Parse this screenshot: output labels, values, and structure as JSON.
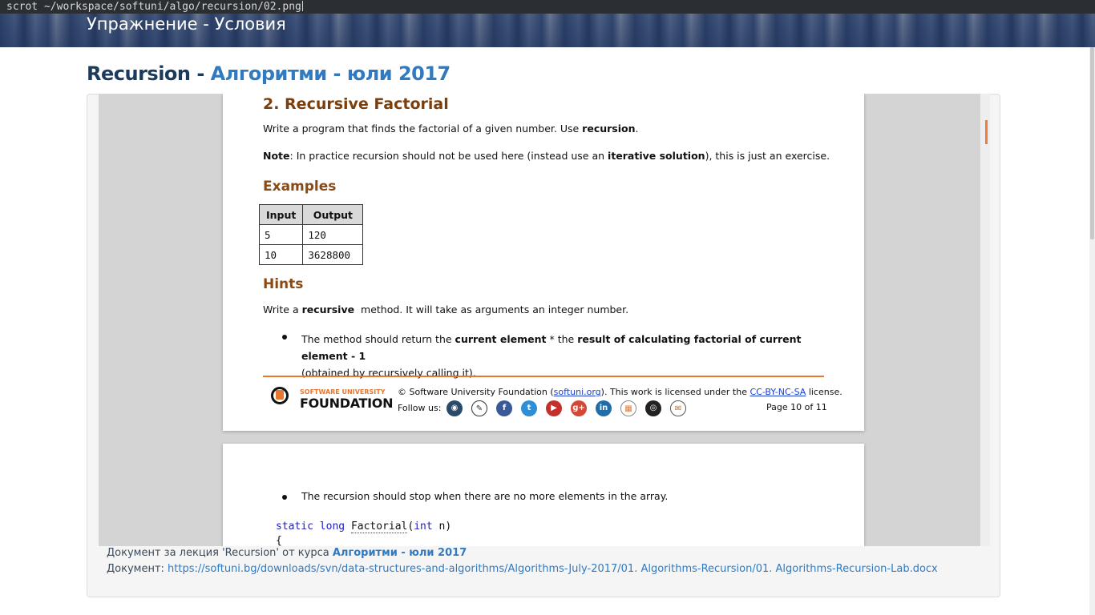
{
  "terminal": {
    "command": "scrot ~/workspace/softuni/algo/recursion/02.png"
  },
  "hero": {
    "title": "Упражнение - Условия"
  },
  "page_title": {
    "part1": "Recursion",
    "separator": " - ",
    "part2": "Алгоритми - юли 2017"
  },
  "document": {
    "heading": "2. Recursive Factorial",
    "intro_prefix": "Write a program that finds the factorial of a given number. Use ",
    "intro_bold": "recursion",
    "intro_suffix": ".",
    "note_label": "Note",
    "note_text": ": In practice recursion should not be used here (instead use an ",
    "note_bold": "iterative solution",
    "note_suffix": "), this is just an exercise.",
    "examples_heading": "Examples",
    "table": {
      "headers": [
        "Input",
        "Output"
      ],
      "rows": [
        [
          "5",
          "120"
        ],
        [
          "10",
          "3628800"
        ]
      ]
    },
    "hints_heading": "Hints",
    "hint_prefix": "Write a ",
    "hint_bold": "recursive",
    "hint_suffix": "  method. It will take as arguments an integer number.",
    "bullet1_a": "The method should return the ",
    "bullet1_b": "current element",
    "bullet1_c": " * the ",
    "bullet1_d": "result of calculating factorial of current element - 1",
    "bullet1_line2": "(obtained by recursively calling it).",
    "footer": {
      "logo_line1": "SOFTWARE UNIVERSITY",
      "logo_line2": "FOUNDATION",
      "copyright_a": "© Software University Foundation (",
      "copyright_link": "softuni.org",
      "copyright_b": "). This work is licensed under the ",
      "license_link": "CC-BY-NC-SA",
      "copyright_c": " license.",
      "follow_us": "Follow us:",
      "page_number": "Page 10 of 11"
    },
    "page2": {
      "bullet": "The recursion should stop when there are no more elements in the array.",
      "code_kw1": "static",
      "code_kw2": "long",
      "code_name": "Factorial",
      "code_paren": "(",
      "code_kw3": "int",
      "code_rest": " n)",
      "code_brace": "{"
    }
  },
  "caption": {
    "line1_prefix": "Документ за лекция 'Recursion' от курса ",
    "line1_course": "Алгоритми - юли 2017",
    "line2_label": "Документ: ",
    "line2_link": "https://softuni.bg/downloads/svn/data-structures-and-algorithms/Algorithms-July-2017/01. Algorithms-Recursion/01. Algorithms-Recursion-Lab.docx"
  },
  "colors": {
    "accent_orange": "#e8772e",
    "title_blue": "#2f7ac1",
    "title_dark": "#1b3a5c"
  }
}
